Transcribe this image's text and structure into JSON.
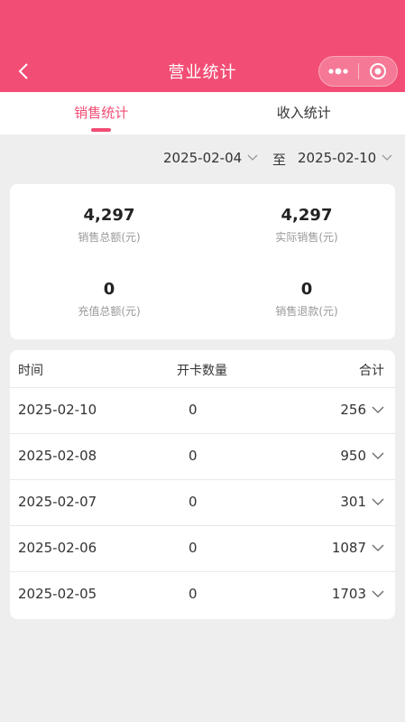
{
  "header": {
    "title": "营业统计",
    "bg_color": "#f24d74"
  },
  "tabs": [
    {
      "label": "销售统计",
      "active": true
    },
    {
      "label": "收入统计",
      "active": false
    }
  ],
  "date_range": {
    "start": "2025-02-04",
    "separator": "至",
    "end": "2025-02-10"
  },
  "summary": {
    "sales_total": {
      "value": "4,297",
      "label": "销售总额(元)"
    },
    "actual_sales": {
      "value": "4,297",
      "label": "实际销售(元)"
    },
    "recharge_total": {
      "value": "0",
      "label": "充值总额(元)"
    },
    "sales_refund": {
      "value": "0",
      "label": "销售退款(元)"
    }
  },
  "table": {
    "headers": {
      "date": "时间",
      "count": "开卡数量",
      "total": "合计"
    },
    "rows": [
      {
        "date": "2025-02-10",
        "count": "0",
        "total": "256"
      },
      {
        "date": "2025-02-08",
        "count": "0",
        "total": "950"
      },
      {
        "date": "2025-02-07",
        "count": "0",
        "total": "301"
      },
      {
        "date": "2025-02-06",
        "count": "0",
        "total": "1087"
      },
      {
        "date": "2025-02-05",
        "count": "0",
        "total": "1703"
      }
    ]
  },
  "icons": {
    "back": "chevron-left-icon",
    "more": "more-dots-icon",
    "close": "target-close-icon",
    "dropdown": "chevron-down-icon",
    "row_expand": "chevron-down-icon"
  }
}
